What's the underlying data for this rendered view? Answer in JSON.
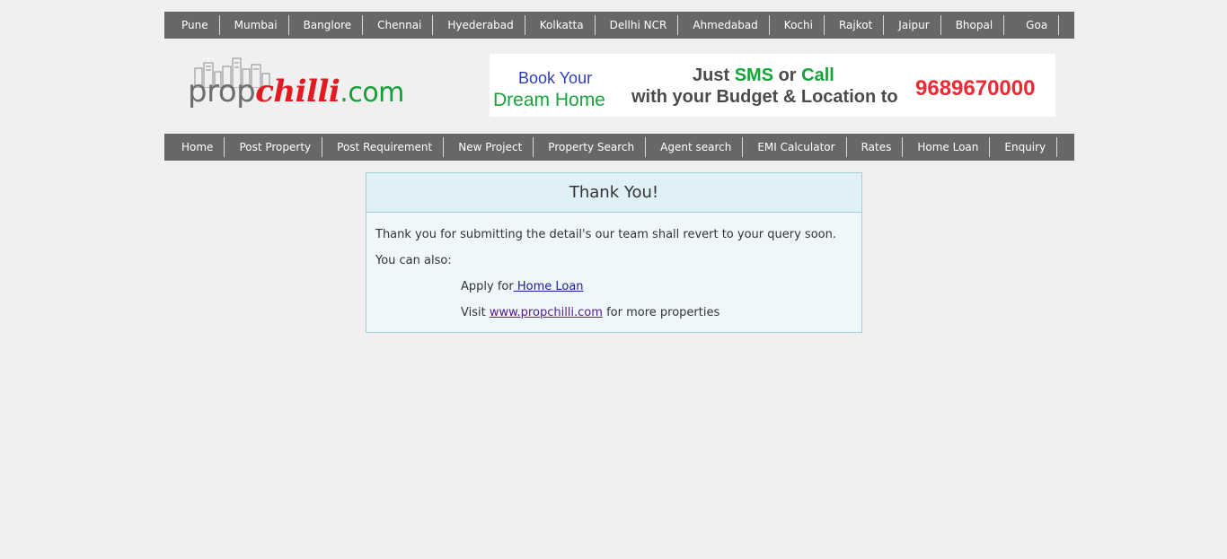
{
  "cities": [
    "Pune",
    "Mumbai",
    "Banglore",
    "Chennai",
    "Hyederabad",
    "Kolkatta",
    "Dellhi NCR",
    "Ahmedabad",
    "Kochi",
    "Rajkot",
    "Jaipur",
    "Bhopal",
    "Goa"
  ],
  "logo": {
    "prop": "prop",
    "chilli": "chilli",
    "com": ".com"
  },
  "banner": {
    "book_your": "Book Your",
    "dream_home": "Dream Home",
    "just": "Just ",
    "sms": "SMS",
    "or": " or ",
    "call": "Call",
    "line2": "with your Budget & Location to",
    "phone": "9689670000"
  },
  "nav": [
    "Home",
    "Post Property",
    "Post Requirement",
    "New Project",
    "Property Search",
    "Agent search",
    "EMI Calculator",
    "Rates",
    "Home Loan",
    "Enquiry"
  ],
  "panel": {
    "title": "Thank You!",
    "message": "Thank you for submitting the detail's our team shall revert to your query soon.",
    "you_can_also": "You can also:",
    "apply_prefix": "Apply for",
    "home_loan_link": " Home Loan",
    "visit_prefix": "Visit ",
    "site_link": "www.propchilli.com",
    "visit_suffix": " for more properties"
  },
  "colors": {
    "page_bg": "#f0f0f0",
    "nav_bg": "#676767",
    "panel_header_bg": "#dff0f6",
    "panel_bg": "#eef8fa",
    "panel_border": "#a8cfd9",
    "brand_red": "#e21b23",
    "brand_green": "#159e3a"
  }
}
